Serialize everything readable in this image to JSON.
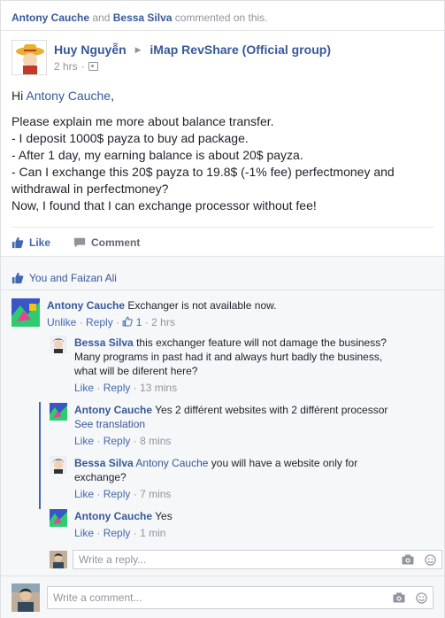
{
  "activity": {
    "user1": "Antony Cauche",
    "and": "and",
    "user2": "Bessa Silva",
    "text": "commented on this."
  },
  "post": {
    "author": "Huy Nguyễn",
    "group": "iMap RevShare (Official group)",
    "time": "2 hrs",
    "greeting": "Hi",
    "greeting_name": "Antony Cauche",
    "greeting_end": ",",
    "lines": [
      "Please explain me more about balance transfer.",
      "- I deposit 1000$ payza to buy ad package.",
      "- After 1 day, my earning balance is about 20$ payza.",
      "- Can I exchange this 20$ payza to 19.8$ (-1% fee) perfectmoney and withdrawal in perfectmoney?",
      "Now, I found that I can exchange processor without fee!"
    ]
  },
  "actions": {
    "like": "Like",
    "comment": "Comment"
  },
  "likes": {
    "text": "You and Faizan Ali"
  },
  "comments": [
    {
      "author": "Antony Cauche",
      "text": "Exchanger is not available now.",
      "unlike": "Unlike",
      "reply": "Reply",
      "like_count": "1",
      "time": "2 hrs"
    },
    {
      "author": "Bessa Silva",
      "text": "this exchanger feature will not damage the business? Many programs in past had it and always hurt badly the business, what will be diferent here?",
      "like": "Like",
      "reply": "Reply",
      "time": "13 mins"
    },
    {
      "author": "Antony Cauche",
      "text": "Yes 2 différent websites with 2 différent processor",
      "see_translation": "See translation",
      "like": "Like",
      "reply": "Reply",
      "time": "8 mins"
    },
    {
      "author": "Bessa Silva",
      "mention": "Antony Cauche",
      "text": "you will have a website only for exchange?",
      "like": "Like",
      "reply": "Reply",
      "time": "7 mins"
    },
    {
      "author": "Antony Cauche",
      "text": "Yes",
      "like": "Like",
      "reply": "Reply",
      "time": "1 min"
    }
  ],
  "reply_box": {
    "placeholder": "Write a reply..."
  },
  "comment_box": {
    "placeholder": "Write a comment..."
  },
  "sep": "·",
  "colors": {
    "link": "#365899",
    "accent": "#4267b2",
    "muted": "#90949c"
  }
}
